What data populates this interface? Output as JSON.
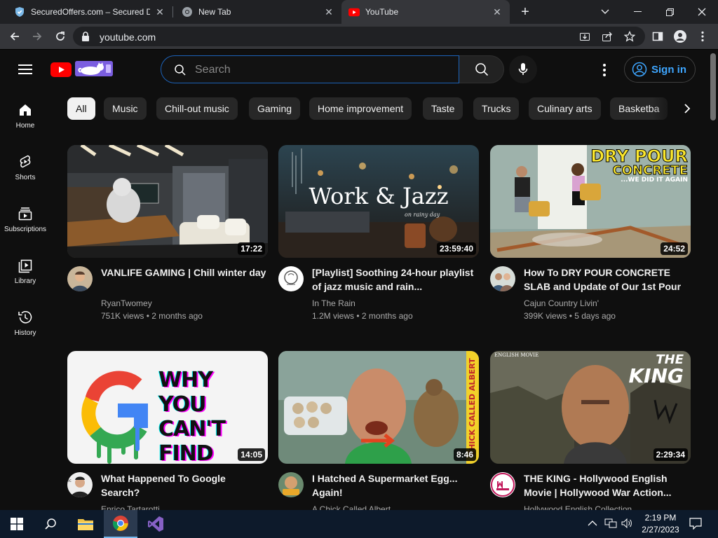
{
  "browser": {
    "tabs": [
      {
        "title": "SecuredOffers.com – Secured Do",
        "icon": "shield-favicon-icon"
      },
      {
        "title": "New Tab",
        "icon": "chrome-favicon-icon"
      },
      {
        "title": "YouTube",
        "icon": "youtube-favicon-icon",
        "active": true
      }
    ],
    "url": "youtube.com"
  },
  "youtube": {
    "search": {
      "placeholder": "Search",
      "value": ""
    },
    "signin_label": "Sign in",
    "sidebar": [
      {
        "label": "Home",
        "icon": "home-icon"
      },
      {
        "label": "Shorts",
        "icon": "shorts-icon"
      },
      {
        "label": "Subscriptions",
        "icon": "subscriptions-icon"
      },
      {
        "label": "Library",
        "icon": "library-icon"
      },
      {
        "label": "History",
        "icon": "history-icon"
      }
    ],
    "chips": [
      "All",
      "Music",
      "Chill-out music",
      "Gaming",
      "Home improvement",
      "Taste",
      "Trucks",
      "Culinary arts",
      "Basketba"
    ],
    "videos": [
      {
        "title": "VANLIFE GAMING | Chill winter day",
        "channel": "RyanTwomey",
        "views": "751K views",
        "age": "2 months ago",
        "duration": "17:22"
      },
      {
        "title": "[Playlist] Soothing 24-hour playlist of jazz music and rain...",
        "channel": "In The Rain",
        "views": "1.2M views",
        "age": "2 months ago",
        "duration": "23:59:40"
      },
      {
        "title": "How To DRY POUR CONCRETE SLAB and Update of Our 1st Pour",
        "channel": "Cajun Country Livin'",
        "views": "399K views",
        "age": "5 days ago",
        "duration": "24:52"
      },
      {
        "title": "What Happened To Google Search?",
        "channel": "Enrico Tartarotti",
        "views": "",
        "age": "",
        "duration": "14:05"
      },
      {
        "title": "I Hatched A Supermarket Egg... Again!",
        "channel": "A Chick Called Albert",
        "views": "",
        "age": "",
        "duration": "8:46"
      },
      {
        "title": "THE KING - Hollywood English Movie | Hollywood War Action...",
        "channel": "Hollywood English Collection",
        "views": "",
        "age": "",
        "duration": "2:29:34"
      }
    ],
    "thumb_text": {
      "jazz": "Work & Jazz",
      "jazz_sub": "on rainy day",
      "concrete_1": "DRY POUR",
      "concrete_2": "CONCRETE",
      "concrete_3": "...WE DID IT AGAIN",
      "google": "WHY YOU CAN'T FIND ANYTHING",
      "chick": "CHICK CALLED ALBERT",
      "king_tag": "ENGLISH MOVIE",
      "king_1": "THE",
      "king_2": "KING"
    }
  },
  "taskbar": {
    "time": "2:19 PM",
    "date": "2/27/2023"
  }
}
